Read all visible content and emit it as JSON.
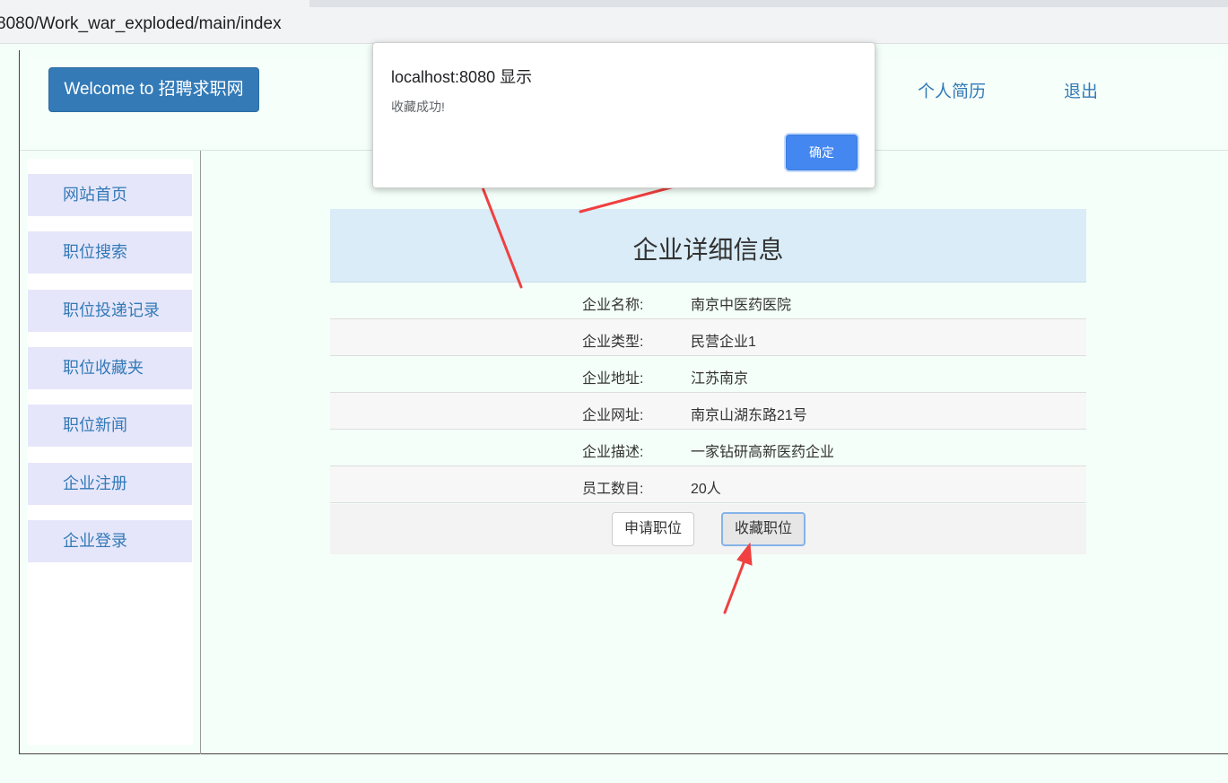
{
  "browser": {
    "url": "8080/Work_war_exploded/main/index"
  },
  "header": {
    "welcome_label": "Welcome to 招聘求职网",
    "nav_resume": "个人简历",
    "nav_logout": "退出"
  },
  "sidebar": {
    "items": [
      {
        "label": "网站首页"
      },
      {
        "label": "职位搜索"
      },
      {
        "label": "职位投递记录"
      },
      {
        "label": "职位收藏夹"
      },
      {
        "label": "职位新闻"
      },
      {
        "label": "企业注册"
      },
      {
        "label": "企业登录"
      }
    ]
  },
  "detail": {
    "title": "企业详细信息",
    "rows": [
      {
        "label": "企业名称:",
        "value": "南京中医药医院"
      },
      {
        "label": "企业类型:",
        "value": "民营企业1"
      },
      {
        "label": "企业地址:",
        "value": "江苏南京"
      },
      {
        "label": "企业网址:",
        "value": "南京山湖东路21号"
      },
      {
        "label": "企业描述:",
        "value": "一家钻研高新医药企业"
      },
      {
        "label": "员工数目:",
        "value": "20人"
      }
    ],
    "apply_label": "申请职位",
    "favorite_label": "收藏职位"
  },
  "dialog": {
    "title": "localhost:8080 显示",
    "message": "收藏成功!",
    "ok_label": "确定"
  },
  "colors": {
    "brand": "#337ab7",
    "page_bg": "#f4fff9",
    "sidebar_item_bg": "#e6e6fa",
    "dialog_button": "#4487f0",
    "annotation_arrow": "#f04040"
  }
}
